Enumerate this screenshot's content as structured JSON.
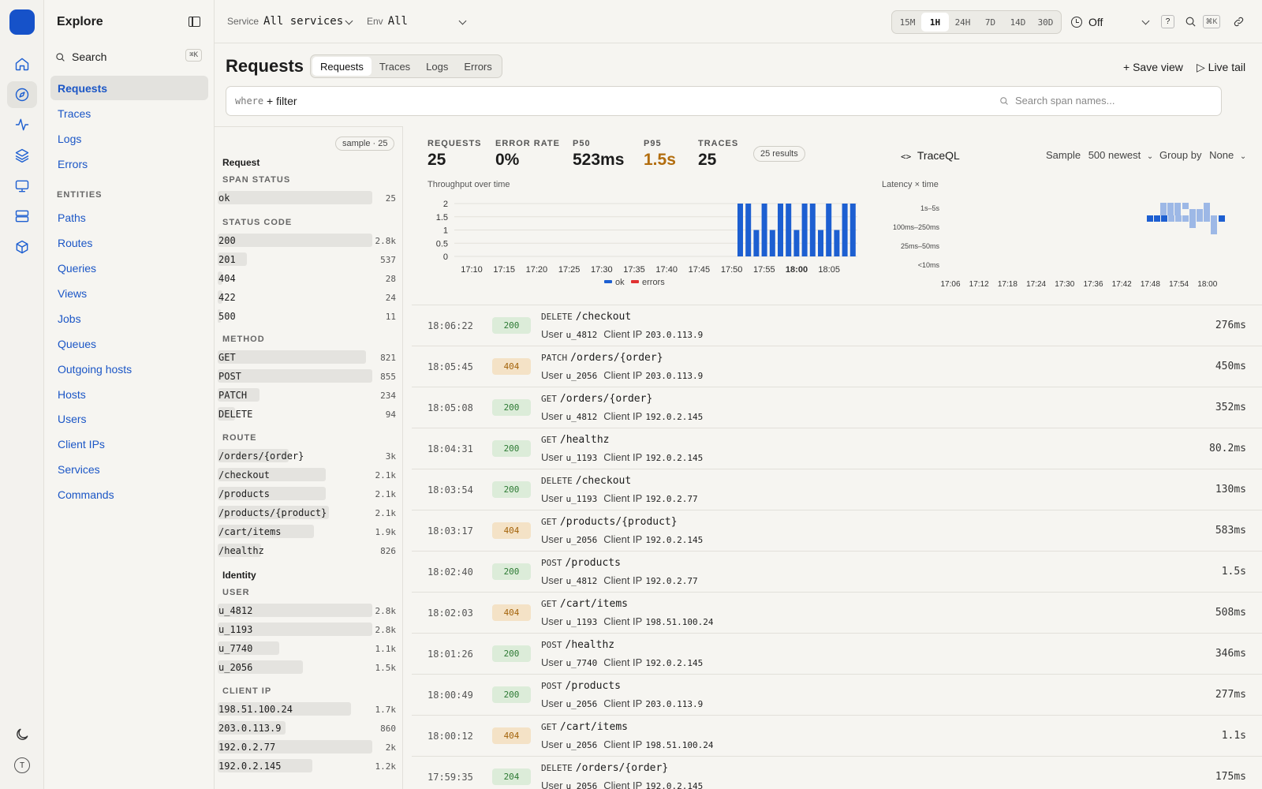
{
  "rail": {
    "icons": [
      "home-icon",
      "compass-icon",
      "activity-icon",
      "layers-icon",
      "monitor-icon",
      "server-icon",
      "box-icon"
    ],
    "avatar_initial": "T"
  },
  "sidebar": {
    "title": "Explore",
    "search_label": "Search",
    "search_kbd": "⌘K",
    "items": [
      {
        "label": "Requests"
      },
      {
        "label": "Traces"
      },
      {
        "label": "Logs"
      },
      {
        "label": "Errors"
      }
    ],
    "entities_heading": "ENTITIES",
    "entities": [
      {
        "label": "Paths"
      },
      {
        "label": "Routes"
      },
      {
        "label": "Queries"
      },
      {
        "label": "Views"
      },
      {
        "label": "Jobs"
      },
      {
        "label": "Queues"
      },
      {
        "label": "Outgoing hosts"
      },
      {
        "label": "Hosts"
      },
      {
        "label": "Users"
      },
      {
        "label": "Client IPs"
      },
      {
        "label": "Services"
      },
      {
        "label": "Commands"
      }
    ]
  },
  "topbar": {
    "service_label": "Service",
    "service_value": "All services",
    "env_label": "Env",
    "env_value": "All",
    "ranges": [
      "15M",
      "1H",
      "24H",
      "7D",
      "14D",
      "30D"
    ],
    "active_range": "1H",
    "refresh_value": "Off",
    "help": "?",
    "kbd": "⌘K"
  },
  "header": {
    "title": "Requests",
    "tabs": [
      "Requests",
      "Traces",
      "Logs",
      "Errors"
    ],
    "save_view": "+ Save view",
    "live_tail": "▷ Live tail",
    "where": "where",
    "add_filter": "+ filter",
    "span_search_placeholder": "Search span names..."
  },
  "facets": {
    "sample_badge": "sample · 25",
    "request_group": "Request",
    "identity_group": "Identity",
    "span_status": {
      "heading": "SPAN STATUS",
      "rows": [
        {
          "label": "ok",
          "count": "25",
          "frac": 1.0
        }
      ]
    },
    "status_code": {
      "heading": "STATUS CODE",
      "rows": [
        {
          "label": "200",
          "count": "2.8k",
          "frac": 1.0
        },
        {
          "label": "201",
          "count": "537",
          "frac": 0.19
        },
        {
          "label": "404",
          "count": "28",
          "frac": 0.03
        },
        {
          "label": "422",
          "count": "24",
          "frac": 0.03
        },
        {
          "label": "500",
          "count": "11",
          "frac": 0.02
        }
      ]
    },
    "method": {
      "heading": "METHOD",
      "rows": [
        {
          "label": "GET",
          "count": "821",
          "frac": 0.96
        },
        {
          "label": "POST",
          "count": "855",
          "frac": 1.0
        },
        {
          "label": "PATCH",
          "count": "234",
          "frac": 0.27
        },
        {
          "label": "DELETE",
          "count": "94",
          "frac": 0.11
        }
      ]
    },
    "route": {
      "heading": "ROUTE",
      "rows": [
        {
          "label": "/orders/{order}",
          "count": "3k",
          "frac": 0.46
        },
        {
          "label": "/checkout",
          "count": "2.1k",
          "frac": 0.7
        },
        {
          "label": "/products",
          "count": "2.1k",
          "frac": 0.7
        },
        {
          "label": "/products/{product}",
          "count": "2.1k",
          "frac": 0.72
        },
        {
          "label": "/cart/items",
          "count": "1.9k",
          "frac": 0.62
        },
        {
          "label": "/healthz",
          "count": "826",
          "frac": 0.28
        }
      ]
    },
    "user": {
      "heading": "USER",
      "rows": [
        {
          "label": "u_4812",
          "count": "2.8k",
          "frac": 1.0
        },
        {
          "label": "u_1193",
          "count": "2.8k",
          "frac": 1.0
        },
        {
          "label": "u_7740",
          "count": "1.1k",
          "frac": 0.4
        },
        {
          "label": "u_2056",
          "count": "1.5k",
          "frac": 0.55
        }
      ]
    },
    "client_ip": {
      "heading": "CLIENT IP",
      "rows": [
        {
          "label": "198.51.100.24",
          "count": "1.7k",
          "frac": 0.86
        },
        {
          "label": "203.0.113.9",
          "count": "860",
          "frac": 0.44
        },
        {
          "label": "192.0.2.77",
          "count": "2k",
          "frac": 1.0
        },
        {
          "label": "192.0.2.145",
          "count": "1.2k",
          "frac": 0.61
        }
      ]
    }
  },
  "stats": [
    {
      "label": "REQUESTS",
      "value": "25"
    },
    {
      "label": "ERROR RATE",
      "value": "0%"
    },
    {
      "label": "P50",
      "value": "523ms"
    },
    {
      "label": "P95",
      "value": "1.5s",
      "color": "#b26d0e"
    },
    {
      "label": "TRACES",
      "value": "25"
    }
  ],
  "results_badge": "25 results",
  "traceql_label": "TraceQL",
  "sample_label": "Sample",
  "sample_value": "500 newest",
  "group_label": "Group by",
  "group_value": "None",
  "colors": {
    "ok": "#1d5fd1",
    "errors": "#e03131",
    "latency_dark": "#1d5fd1",
    "latency_light": "#9db8e6"
  },
  "chart_data": [
    {
      "type": "bar",
      "title": "Throughput over time",
      "ylim": [
        0,
        2
      ],
      "yticks": [
        "0",
        "0.5",
        "1",
        "1.5",
        "2"
      ],
      "xticks": [
        "17:10",
        "17:15",
        "17:20",
        "17:25",
        "17:30",
        "17:35",
        "17:40",
        "17:45",
        "17:50",
        "17:55",
        "18:00",
        "18:05"
      ],
      "bold_tick": "18:00",
      "series": [
        {
          "name": "ok",
          "values": [
            2,
            2,
            1,
            2,
            1,
            2,
            2,
            1,
            2,
            2,
            1,
            2,
            1,
            2,
            2
          ]
        },
        {
          "name": "errors",
          "values": [
            0,
            0,
            0,
            0,
            0,
            0,
            0,
            0,
            0,
            0,
            0,
            0,
            0,
            0,
            0
          ]
        }
      ]
    },
    {
      "type": "heatmap",
      "title": "Latency × time",
      "ylabels": [
        "1s–5s",
        "100ms–250ms",
        "25ms–50ms",
        "<10ms"
      ],
      "xticks": [
        "17:06",
        "17:12",
        "17:18",
        "17:24",
        "17:30",
        "17:36",
        "17:42",
        "17:48",
        "17:54",
        "18:00"
      ]
    }
  ],
  "requests": [
    {
      "time": "18:06:22",
      "status": "200",
      "method": "DELETE",
      "path": "/checkout",
      "user": "u_4812",
      "ip": "203.0.113.9",
      "duration": "276ms"
    },
    {
      "time": "18:05:45",
      "status": "404",
      "method": "PATCH",
      "path": "/orders/{order}",
      "user": "u_2056",
      "ip": "203.0.113.9",
      "duration": "450ms"
    },
    {
      "time": "18:05:08",
      "status": "200",
      "method": "GET",
      "path": "/orders/{order}",
      "user": "u_4812",
      "ip": "192.0.2.145",
      "duration": "352ms"
    },
    {
      "time": "18:04:31",
      "status": "200",
      "method": "GET",
      "path": "/healthz",
      "user": "u_1193",
      "ip": "192.0.2.145",
      "duration": "80.2ms"
    },
    {
      "time": "18:03:54",
      "status": "200",
      "method": "DELETE",
      "path": "/checkout",
      "user": "u_1193",
      "ip": "192.0.2.77",
      "duration": "130ms"
    },
    {
      "time": "18:03:17",
      "status": "404",
      "method": "GET",
      "path": "/products/{product}",
      "user": "u_2056",
      "ip": "192.0.2.145",
      "duration": "583ms"
    },
    {
      "time": "18:02:40",
      "status": "200",
      "method": "POST",
      "path": "/products",
      "user": "u_4812",
      "ip": "192.0.2.77",
      "duration": "1.5s"
    },
    {
      "time": "18:02:03",
      "status": "404",
      "method": "GET",
      "path": "/cart/items",
      "user": "u_1193",
      "ip": "198.51.100.24",
      "duration": "508ms"
    },
    {
      "time": "18:01:26",
      "status": "200",
      "method": "POST",
      "path": "/healthz",
      "user": "u_7740",
      "ip": "192.0.2.145",
      "duration": "346ms"
    },
    {
      "time": "18:00:49",
      "status": "200",
      "method": "POST",
      "path": "/products",
      "user": "u_2056",
      "ip": "203.0.113.9",
      "duration": "277ms"
    },
    {
      "time": "18:00:12",
      "status": "404",
      "method": "GET",
      "path": "/cart/items",
      "user": "u_2056",
      "ip": "198.51.100.24",
      "duration": "1.1s"
    },
    {
      "time": "17:59:35",
      "status": "204",
      "method": "DELETE",
      "path": "/orders/{order}",
      "user": "u_2056",
      "ip": "192.0.2.145",
      "duration": "175ms"
    }
  ],
  "request_labels": {
    "user": "User",
    "client_ip": "Client IP"
  }
}
